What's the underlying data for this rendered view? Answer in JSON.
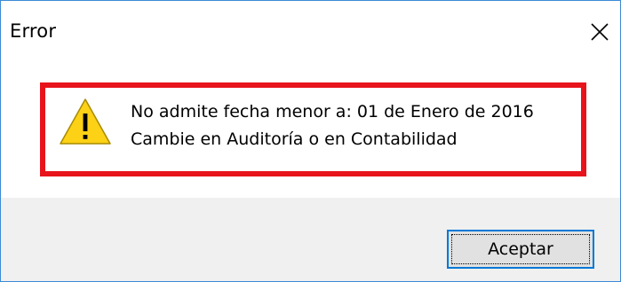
{
  "window": {
    "title": "Error",
    "close_icon": "close-icon"
  },
  "message": {
    "icon": "warning-icon",
    "line1": "No admite fecha menor a: 01 de Enero de 2016",
    "line2": "Cambie en Auditoría o en Contabilidad"
  },
  "buttons": {
    "accept_label": "Aceptar"
  },
  "colors": {
    "highlight_border": "#e8141c",
    "warning_fill": "#fcd116",
    "footer_bg": "#f0f0f0",
    "button_focus": "#0078d7"
  }
}
